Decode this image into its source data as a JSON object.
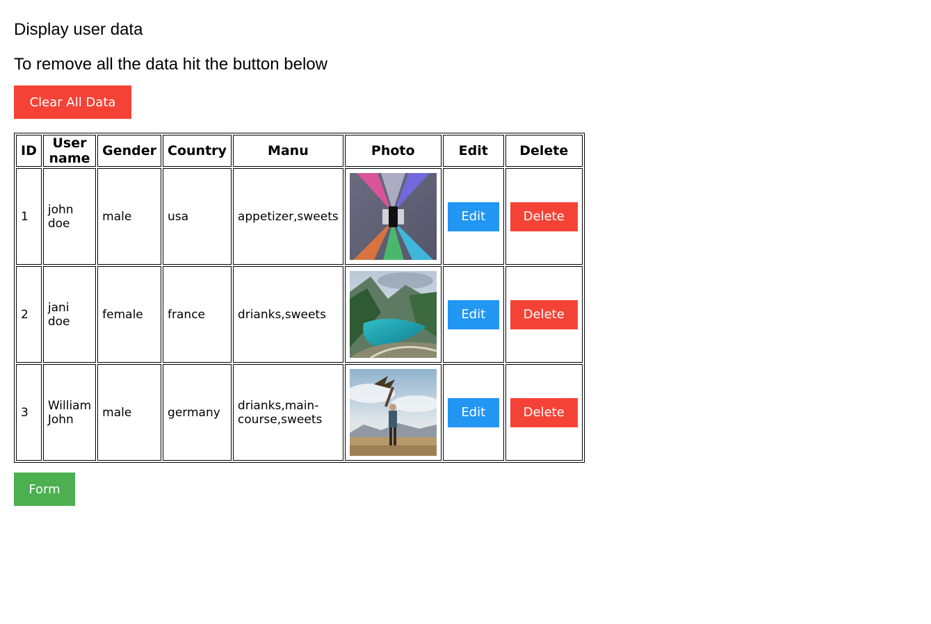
{
  "page": {
    "title": "Display user data",
    "subtitle": "To remove all the data hit the button below",
    "clear_button": "Clear All Data",
    "form_button": "Form"
  },
  "table": {
    "headers": [
      "ID",
      "User name",
      "Gender",
      "Country",
      "Manu",
      "Photo",
      "Edit",
      "Delete"
    ],
    "rows": [
      {
        "id": "1",
        "username": "john doe",
        "gender": "male",
        "country": "usa",
        "manu": "appetizer,sweets",
        "photo": "wall-lamp-photo",
        "edit": "Edit",
        "delete": "Delete"
      },
      {
        "id": "2",
        "username": "jani doe",
        "gender": "female",
        "country": "france",
        "manu": "drianks,sweets",
        "photo": "mountain-lake-photo",
        "edit": "Edit",
        "delete": "Delete"
      },
      {
        "id": "3",
        "username": "William John",
        "gender": "male",
        "country": "germany",
        "manu": "drianks,main-course,sweets",
        "photo": "falconer-photo",
        "edit": "Edit",
        "delete": "Delete"
      }
    ]
  },
  "colors": {
    "danger": "#f44336",
    "primary": "#2196f3",
    "success": "#4caf50"
  }
}
